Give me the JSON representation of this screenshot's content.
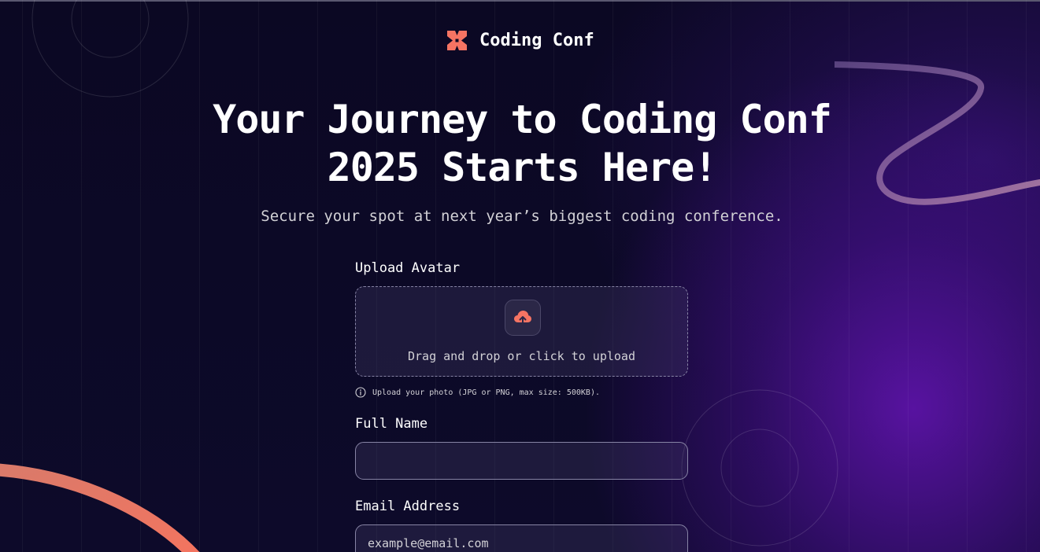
{
  "brand": {
    "name": "Coding Conf",
    "logo_icon": "coding-conf-logo-icon",
    "accent_color": "#f57463"
  },
  "hero": {
    "title_line1": "Your Journey to Coding Conf",
    "title_line2": "2025 Starts Here!",
    "subtitle": "Secure your spot at next year’s biggest coding conference."
  },
  "form": {
    "avatar": {
      "label": "Upload Avatar",
      "icon": "cloud-upload-icon",
      "drop_text": "Drag and drop or click to upload",
      "hint_icon": "info-icon",
      "hint": "Upload your photo (JPG or PNG, max size: 500KB)."
    },
    "full_name": {
      "label": "Full Name",
      "value": "",
      "placeholder": ""
    },
    "email": {
      "label": "Email Address",
      "value": "",
      "placeholder": "example@email.com"
    }
  }
}
